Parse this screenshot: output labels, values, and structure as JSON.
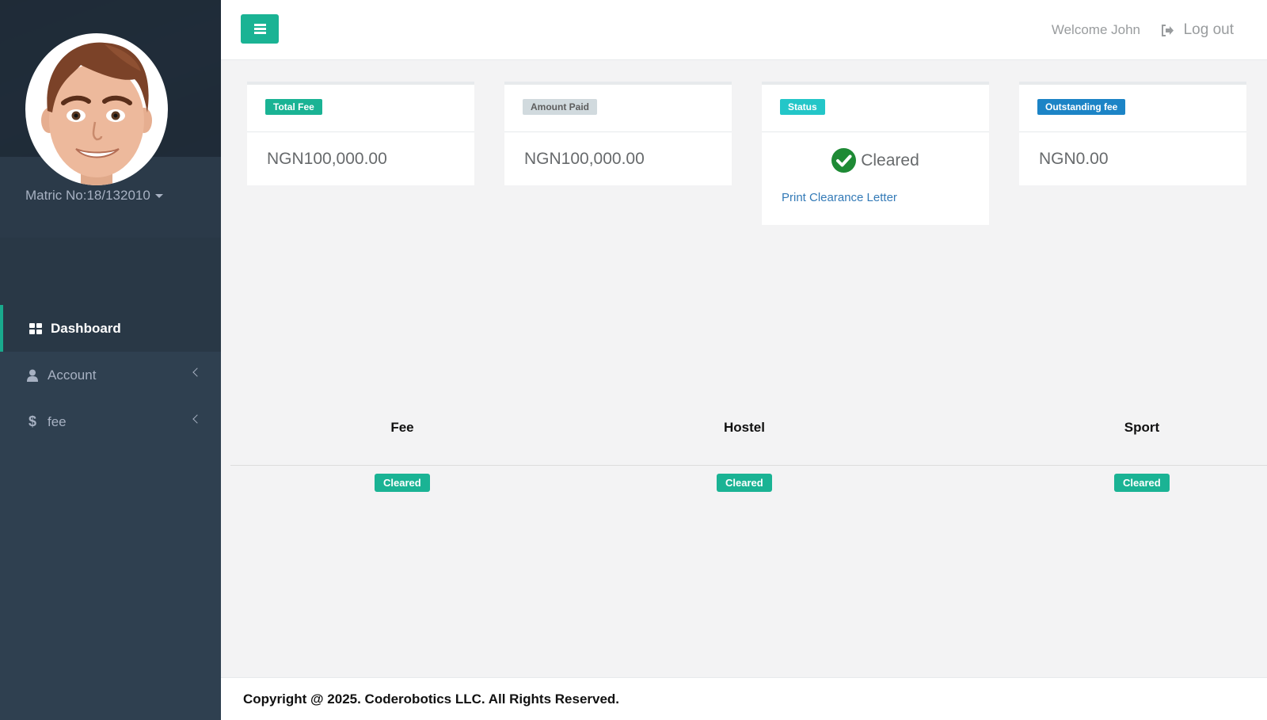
{
  "sidebar": {
    "matric": "Matric No:18/132010",
    "items": [
      {
        "label": "Dashboard",
        "icon": "dashboard-icon",
        "active": true
      },
      {
        "label": "Account",
        "icon": "user-icon"
      },
      {
        "label": "fee",
        "icon": "dollar-icon"
      }
    ]
  },
  "topbar": {
    "welcome": "Welcome John",
    "logout": "Log out"
  },
  "cards": {
    "total_fee": {
      "label": "Total Fee",
      "value": "NGN100,000.00",
      "color": "#1ab394"
    },
    "amount_paid": {
      "label": "Amount Paid",
      "value": "NGN100,000.00",
      "color": "#d1dade"
    },
    "status": {
      "label": "Status",
      "value": "Cleared",
      "link": "Print Clearance Letter",
      "color": "#23c6c8"
    },
    "outstanding": {
      "label": "Outstanding fee",
      "value": "NGN0.00",
      "color": "#1c84c6"
    }
  },
  "clearance": {
    "columns": [
      {
        "header": "Fee",
        "status": "Cleared"
      },
      {
        "header": "Hostel",
        "status": "Cleared"
      },
      {
        "header": "Sport",
        "status": "Cleared"
      }
    ]
  },
  "footer": {
    "copyright": "Copyright @ 2025. Coderobotics LLC. All Rights Reserved."
  },
  "colors": {
    "accent": "#1ab394",
    "sidebar": "#2f4050",
    "check": "#1e8a35"
  }
}
